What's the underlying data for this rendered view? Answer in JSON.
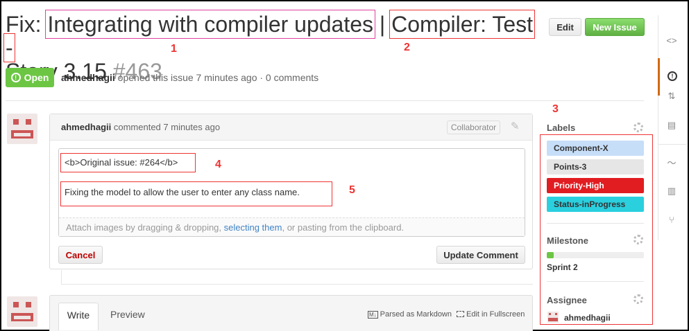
{
  "issue": {
    "title_prefix": "Fix: ",
    "title_highlight1": "Integrating with compiler updates",
    "title_sep": " | ",
    "title_highlight2": "Compiler: Test -",
    "title_rest": "Story 3.15 ",
    "number": "#463",
    "state": "Open",
    "author": "ahmedhagii",
    "opened_text": " opened this issue 7 minutes ago · 0 comments"
  },
  "actions": {
    "edit": "Edit",
    "new_issue": "New Issue"
  },
  "annotations": [
    "1",
    "2",
    "3",
    "4",
    "5"
  ],
  "comment": {
    "author": "ahmedhagii",
    "commented_text": " commented 7 minutes ago",
    "badge": "Collaborator",
    "line1": "<b>Original issue: #264</b>",
    "line2": "Fixing the model to allow the user to enter any class name.",
    "attach_pre": "Attach images by dragging & dropping, ",
    "attach_link": "selecting them",
    "attach_post": ", or pasting from the clipboard.",
    "cancel": "Cancel",
    "update": "Update Comment"
  },
  "composer": {
    "tab_write": "Write",
    "tab_preview": "Preview",
    "markdown_note": "Parsed as Markdown",
    "fullscreen": "Edit in Fullscreen"
  },
  "sidebar": {
    "labels_heading": "Labels",
    "labels": [
      {
        "name": "Component-X",
        "bg": "#c7def8",
        "fg": "#333333"
      },
      {
        "name": "Points-3",
        "bg": "#e6e6e6",
        "fg": "#333333"
      },
      {
        "name": "Priority-High",
        "bg": "#e11d21",
        "fg": "#ffffff"
      },
      {
        "name": "Status-inProgress",
        "bg": "#2bd0df",
        "fg": "#333333"
      }
    ],
    "milestone_heading": "Milestone",
    "milestone_name": "Sprint 2",
    "milestone_progress": 0.07,
    "assignee_heading": "Assignee",
    "assignee_name": "ahmedhagii"
  },
  "rail_icons": [
    "code-icon",
    "issues-icon",
    "pull-requests-icon",
    "wiki-icon",
    "pulse-icon",
    "graphs-icon",
    "network-icon"
  ]
}
